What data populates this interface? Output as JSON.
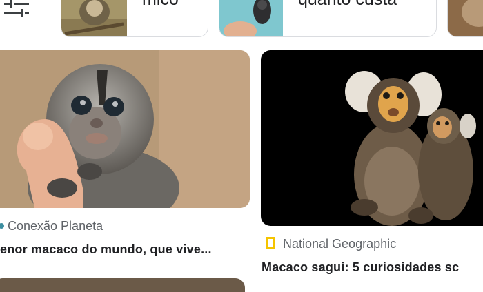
{
  "chips": [
    {
      "label": "mico",
      "thumb_icon": "marmoset-thumbnail"
    },
    {
      "label": "quanto custa",
      "thumb_icon": "marmoset-in-hand-thumbnail"
    },
    {
      "label": "",
      "thumb_icon": "marmoset-thumbnail"
    }
  ],
  "results": [
    {
      "source": "Conexão Planeta",
      "title": "enor macaco do mundo, que vive...",
      "favicon_color": "#3c8ea0"
    },
    {
      "source": "National Geographic",
      "title": "Macaco sagui: 5 curiosidades sc",
      "logo_color": "#f5c400"
    }
  ],
  "icons": {
    "filter": "tune-icon"
  }
}
